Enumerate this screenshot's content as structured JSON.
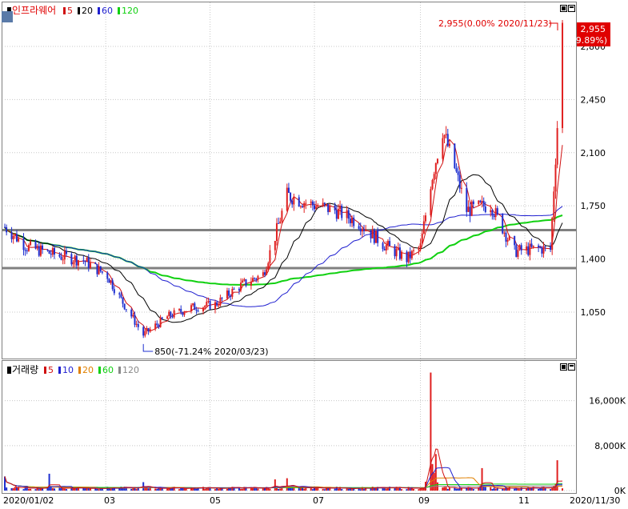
{
  "colors": {
    "up": "#e02020",
    "down": "#1e2fd0",
    "ma5": "#d01010",
    "ma20": "#000000",
    "ma60": "#2020d0",
    "ma120": "#10d010",
    "vol_ma20": "#e08000",
    "vol_ma120": "#888888",
    "level_line": "#808080"
  },
  "price_panel": {
    "legend_name": "인프라웨어",
    "legend_items": [
      "5",
      "20",
      "60",
      "120"
    ],
    "current_label": "2,955(0.00% 2020/11/23)",
    "current_value_box": "2,955",
    "current_change_box": "( 29.89%)",
    "low_label": "850(-71.24% 2020/03/23)"
  },
  "volume_panel": {
    "legend_name": "거래량",
    "legend_items": [
      "5",
      "10",
      "20",
      "60",
      "120"
    ]
  },
  "chart_data": [
    {
      "type": "candlestick",
      "title": "인프라웨어",
      "y_ticks": [
        2800,
        2450,
        2100,
        1750,
        1400,
        1050
      ],
      "y_tick_labels": [
        "2,800",
        "2,450",
        "2,100",
        "1,750",
        "1,400",
        "1,050"
      ],
      "ylim": [
        760,
        3000
      ],
      "x_tick_labels": [
        "2020/01/02",
        "03",
        "05",
        "07",
        "09",
        "11",
        "2020/11/30"
      ],
      "horizontal_levels": [
        1590,
        1340
      ],
      "annotations": [
        {
          "text": "2,955(0.00% 2020/11/23)",
          "value": 2955
        },
        {
          "text": "850(-71.24% 2020/03/23)",
          "value": 850
        }
      ],
      "moving_averages": [
        "5",
        "20",
        "60",
        "120"
      ],
      "series_close": [
        {
          "date": "2020-01-02",
          "close": 1610
        },
        {
          "date": "2020-01-15",
          "close": 1480
        },
        {
          "date": "2020-02-03",
          "close": 1420
        },
        {
          "date": "2020-02-17",
          "close": 1390
        },
        {
          "date": "2020-03-02",
          "close": 1290
        },
        {
          "date": "2020-03-09",
          "close": 1150
        },
        {
          "date": "2020-03-23",
          "close": 900
        },
        {
          "date": "2020-04-06",
          "close": 1020
        },
        {
          "date": "2020-04-20",
          "close": 1080
        },
        {
          "date": "2020-05-04",
          "close": 1100
        },
        {
          "date": "2020-05-18",
          "close": 1220
        },
        {
          "date": "2020-06-01",
          "close": 1300
        },
        {
          "date": "2020-06-08",
          "close": 1550
        },
        {
          "date": "2020-06-15",
          "close": 1820
        },
        {
          "date": "2020-06-29",
          "close": 1760
        },
        {
          "date": "2020-07-13",
          "close": 1720
        },
        {
          "date": "2020-07-27",
          "close": 1640
        },
        {
          "date": "2020-08-10",
          "close": 1500
        },
        {
          "date": "2020-08-24",
          "close": 1400
        },
        {
          "date": "2020-09-01",
          "close": 1480
        },
        {
          "date": "2020-09-07",
          "close": 1900
        },
        {
          "date": "2020-09-14",
          "close": 2250
        },
        {
          "date": "2020-09-21",
          "close": 2000
        },
        {
          "date": "2020-09-28",
          "close": 1720
        },
        {
          "date": "2020-10-12",
          "close": 1760
        },
        {
          "date": "2020-10-26",
          "close": 1450
        },
        {
          "date": "2020-11-09",
          "close": 1470
        },
        {
          "date": "2020-11-16",
          "close": 1460
        },
        {
          "date": "2020-11-20",
          "close": 2275
        },
        {
          "date": "2020-11-23",
          "close": 2955
        }
      ]
    },
    {
      "type": "bar",
      "title": "거래량",
      "y_ticks": [
        16000,
        8000,
        0
      ],
      "y_tick_labels": [
        "16,000K",
        "8,000K",
        "0K"
      ],
      "ylim": [
        0,
        21500
      ],
      "moving_averages": [
        "5",
        "10",
        "20",
        "60",
        "120"
      ],
      "peaks": [
        {
          "date": "2020-01-02",
          "value": 2500
        },
        {
          "date": "2020-01-28",
          "value": 3000
        },
        {
          "date": "2020-03-23",
          "value": 1500
        },
        {
          "date": "2020-06-08",
          "value": 2000
        },
        {
          "date": "2020-06-15",
          "value": 2200
        },
        {
          "date": "2020-09-07",
          "value": 21000
        },
        {
          "date": "2020-09-10",
          "value": 6500
        },
        {
          "date": "2020-10-07",
          "value": 4000
        },
        {
          "date": "2020-11-20",
          "value": 5400
        }
      ]
    }
  ]
}
